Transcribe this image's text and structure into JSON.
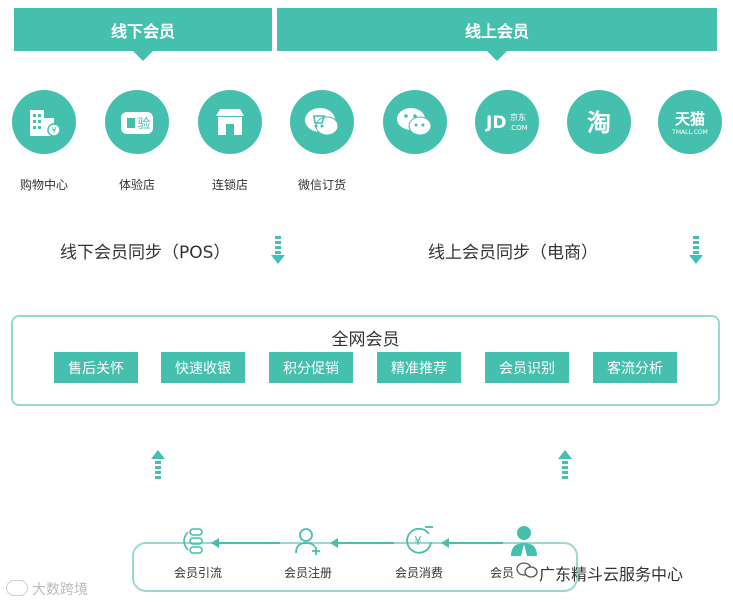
{
  "banners": {
    "offline": "线下会员",
    "online": "线上会员"
  },
  "channels": [
    {
      "icon": "mall-icon",
      "label": "购物中心"
    },
    {
      "icon": "experience-store-icon",
      "label": "体验店"
    },
    {
      "icon": "chain-store-icon",
      "label": "连锁店"
    },
    {
      "icon": "wechat-ordering-icon",
      "label": "微信订货"
    },
    {
      "icon": "wechat-icon",
      "label": ""
    },
    {
      "icon": "jd-icon",
      "label": ""
    },
    {
      "icon": "taobao-icon",
      "label": ""
    },
    {
      "icon": "tmall-icon",
      "label": ""
    }
  ],
  "icon_text": {
    "experience": "验",
    "jd": "JD",
    "jd_small": "京东",
    "jd_com": ".COM",
    "taobao": "淘",
    "tmall": "天猫",
    "tmall_com": "TMALL.COM"
  },
  "sync": {
    "offline": "线下会员同步（POS）",
    "online": "线上会员同步（电商）"
  },
  "panel": {
    "title": "全网会员",
    "features": [
      "售后关怀",
      "快速收银",
      "积分促销",
      "精准推荐",
      "会员识别",
      "客流分析"
    ]
  },
  "flow": [
    "会员引流",
    "会员注册",
    "会员消费",
    "会员"
  ],
  "watermarks": {
    "right": "广东精斗云服务中心",
    "left": "大数跨境"
  },
  "colors": {
    "accent": "#45bfae",
    "border": "#9ad9cf"
  }
}
